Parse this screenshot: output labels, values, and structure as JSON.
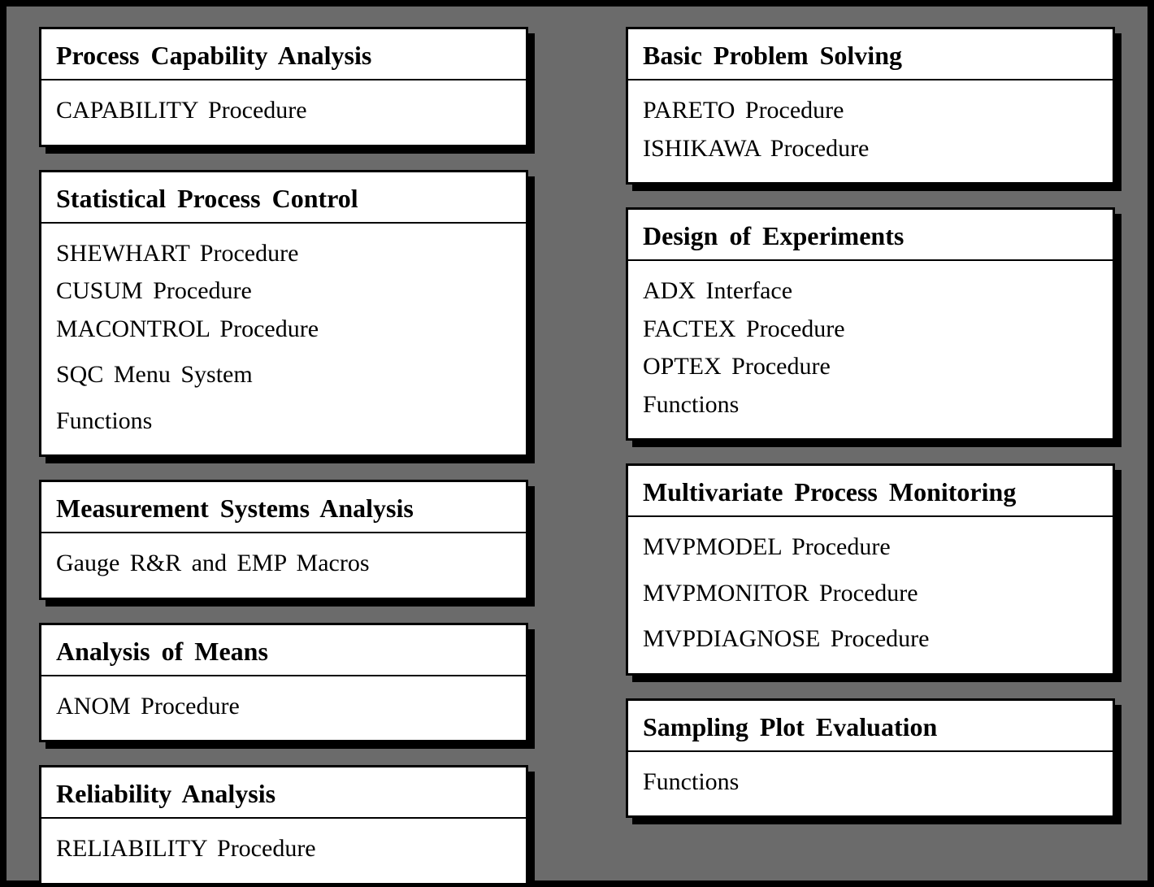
{
  "left_column": [
    {
      "title": "Process Capability Analysis",
      "items": [
        "CAPABILITY Procedure"
      ]
    },
    {
      "title": "Statistical Process Control",
      "items": [
        "SHEWHART Procedure",
        "CUSUM Procedure",
        "MACONTROL Procedure",
        "SQC Menu System",
        "Functions"
      ]
    },
    {
      "title": "Measurement Systems Analysis",
      "items": [
        "Gauge R&R and EMP Macros"
      ]
    },
    {
      "title": "Analysis of Means",
      "items": [
        "ANOM Procedure"
      ]
    },
    {
      "title": "Reliability Analysis",
      "items": [
        "RELIABILITY Procedure"
      ]
    }
  ],
  "right_column": [
    {
      "title": "Basic Problem Solving",
      "items": [
        "PARETO Procedure",
        "ISHIKAWA Procedure"
      ]
    },
    {
      "title": "Design of Experiments",
      "items": [
        "ADX Interface",
        "FACTEX Procedure",
        "OPTEX Procedure",
        "Functions"
      ]
    },
    {
      "title": "Multivariate Process Monitoring",
      "items": [
        "MVPMODEL Procedure",
        "MVPMONITOR Procedure",
        "MVPDIAGNOSE Procedure"
      ]
    },
    {
      "title": "Sampling Plot Evaluation",
      "items": [
        "Functions"
      ]
    }
  ]
}
